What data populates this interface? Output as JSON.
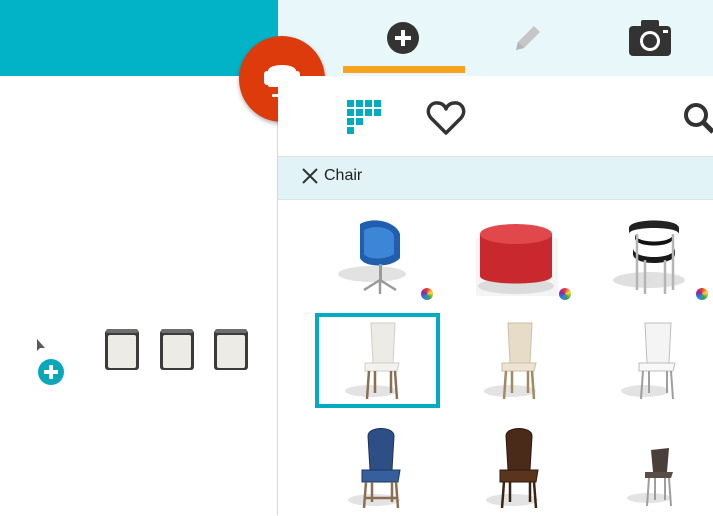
{
  "colors": {
    "accent": "#02b3c8",
    "active_tab": "#f6a31d",
    "fab": "#dd3b0b",
    "selection": "#00acc1",
    "filter_bar": "#e1f3f7"
  },
  "tabs": [
    {
      "icon": "plus-circle-icon",
      "active": true
    },
    {
      "icon": "pencil-icon",
      "active": false
    },
    {
      "icon": "camera-icon",
      "active": false
    }
  ],
  "toolbar": {
    "icons": [
      "grid-icon",
      "heart-icon",
      "search-icon"
    ]
  },
  "filter": {
    "label": "Chair"
  },
  "catalog": {
    "items": [
      {
        "kind": "blue-lounge-chair",
        "has_colors": true,
        "selected": false
      },
      {
        "kind": "red-round-ottoman",
        "has_colors": true,
        "selected": false
      },
      {
        "kind": "black-ring-chair",
        "has_colors": true,
        "selected": false
      },
      {
        "kind": "white-dining-chair",
        "has_colors": false,
        "selected": true
      },
      {
        "kind": "beige-dining-chair",
        "has_colors": false,
        "selected": false
      },
      {
        "kind": "white-metal-chair",
        "has_colors": false,
        "selected": false
      },
      {
        "kind": "blue-upholstered-chair",
        "has_colors": false,
        "selected": false
      },
      {
        "kind": "brown-upholstered-chair",
        "has_colors": false,
        "selected": false
      },
      {
        "kind": "dark-slim-chair",
        "has_colors": false,
        "selected": false
      }
    ]
  }
}
